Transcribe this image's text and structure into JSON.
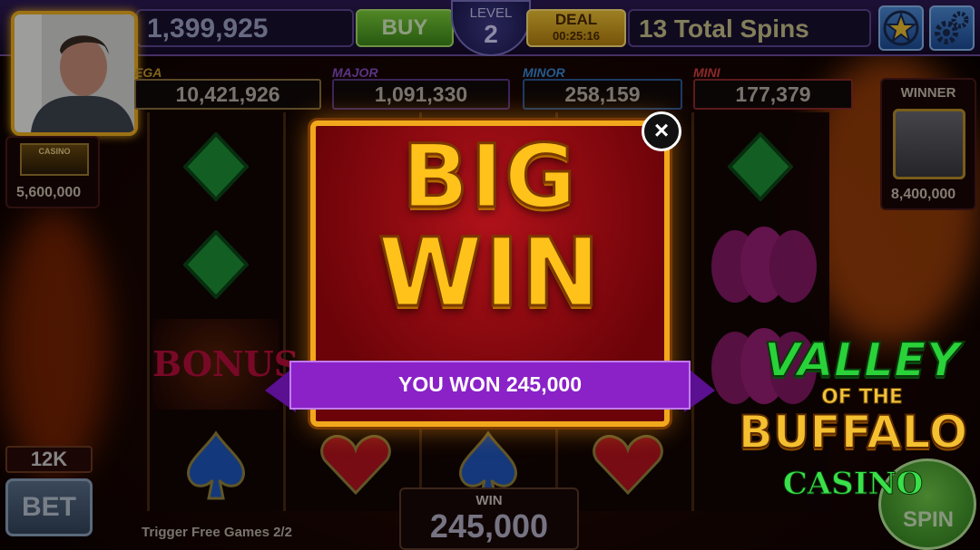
{
  "topbar": {
    "coins": "1,399,925",
    "buy_label": "BUY",
    "level_label": "LEVEL",
    "level_value": "2",
    "deal_label": "DEAL",
    "deal_timer": "00:25:16",
    "spins_text": "13 Total Spins"
  },
  "jackpots": [
    {
      "name": "MEGA",
      "value": "10,421,926",
      "color": "#c79a30",
      "name_shown": "EGA"
    },
    {
      "name": "MAJOR",
      "value": "1,091,330",
      "color": "#8a4fc8"
    },
    {
      "name": "MINOR",
      "value": "258,159",
      "color": "#3a8ad8"
    },
    {
      "name": "MINI",
      "value": "177,379",
      "color": "#d84040"
    }
  ],
  "side_left": {
    "value": "5,600,000",
    "badge": "CASINO"
  },
  "side_right": {
    "label": "WINNER",
    "value": "8,400,000"
  },
  "modal": {
    "line1": "BIG",
    "line2": "WIN",
    "message": "YOU WON 245,000",
    "close_icon": "close-icon"
  },
  "reel_bonus": "BONUS",
  "bottom": {
    "bet_amount": "12K",
    "bet_label": "BET",
    "trigger_text": "Trigger Free Games 2/2",
    "win_label": "WIN",
    "win_value": "245,000",
    "spin_label": "SPIN"
  },
  "logo": {
    "line1": "VALLEY",
    "line2": "OF THE",
    "line3": "BUFFALO",
    "line4": "CASINO"
  },
  "colors": {
    "gold": "#ffc21a",
    "ribbon": "#8a22c8",
    "modal_red": "#b1121a"
  }
}
